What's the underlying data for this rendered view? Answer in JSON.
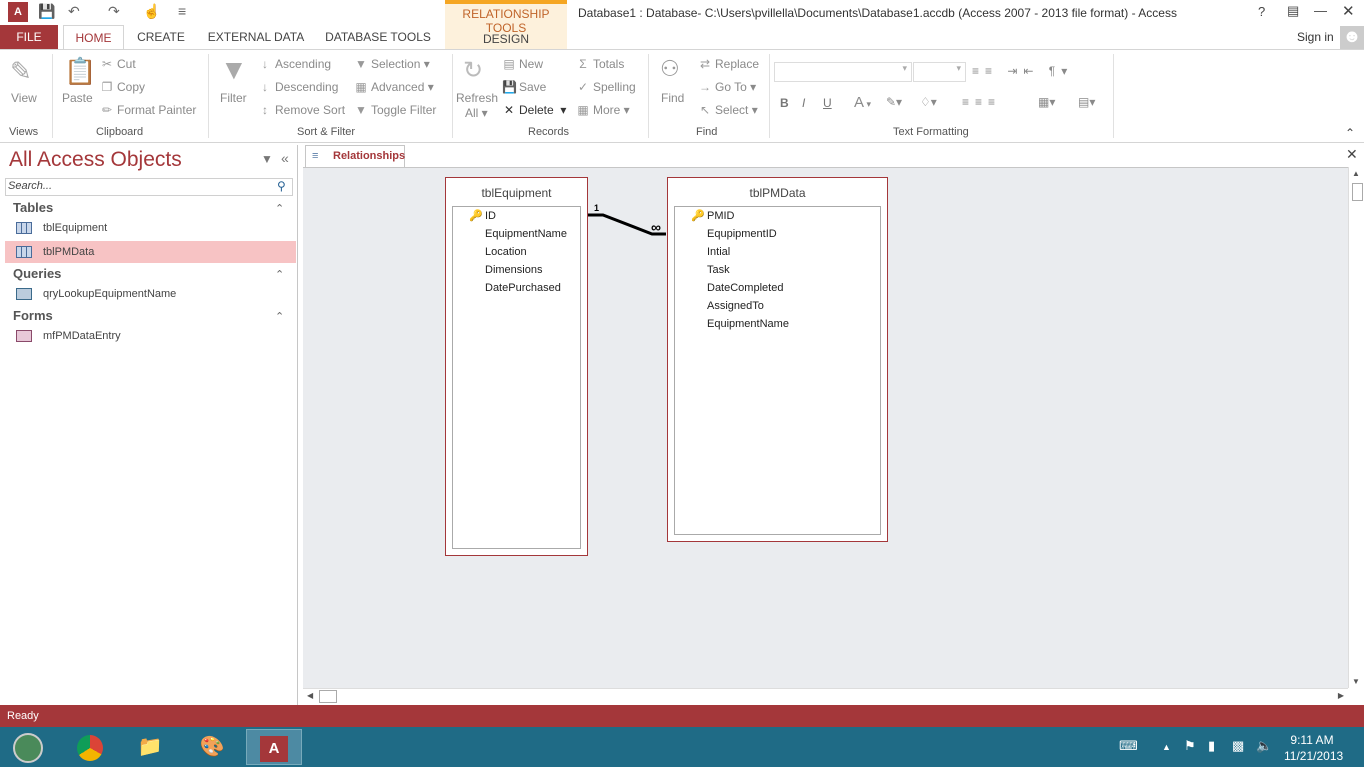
{
  "window": {
    "title": "Database1 : Database- C:\\Users\\pvillella\\Documents\\Database1.accdb (Access 2007 - 2013 file format) - Access",
    "help": "?",
    "sign_in": "Sign in"
  },
  "context_tab": {
    "group": "RELATIONSHIP TOOLS",
    "tab": "DESIGN"
  },
  "tabs": [
    "FILE",
    "HOME",
    "CREATE",
    "EXTERNAL DATA",
    "DATABASE TOOLS"
  ],
  "ribbon": {
    "views": {
      "view": "View",
      "label": "Views"
    },
    "clipboard": {
      "paste": "Paste",
      "cut": "Cut",
      "copy": "Copy",
      "format_painter": "Format Painter",
      "label": "Clipboard"
    },
    "sort_filter": {
      "filter": "Filter",
      "ascending": "Ascending",
      "descending": "Descending",
      "remove_sort": "Remove Sort",
      "selection": "Selection",
      "advanced": "Advanced",
      "toggle_filter": "Toggle Filter",
      "label": "Sort & Filter"
    },
    "records": {
      "refresh": "Refresh",
      "all": "All",
      "new": "New",
      "save": "Save",
      "delete": "Delete",
      "totals": "Totals",
      "spelling": "Spelling",
      "more": "More",
      "label": "Records"
    },
    "find": {
      "find": "Find",
      "replace": "Replace",
      "goto": "Go To",
      "select": "Select",
      "label": "Find"
    },
    "text_formatting": {
      "bold": "B",
      "italic": "I",
      "underline": "U",
      "font_color": "A",
      "label": "Text Formatting"
    }
  },
  "nav": {
    "title": "All Access Objects",
    "search_placeholder": "Search...",
    "groups": [
      {
        "name": "Tables",
        "items": [
          "tblEquipment",
          "tblPMData"
        ]
      },
      {
        "name": "Queries",
        "items": [
          "qryLookupEquipmentName"
        ]
      },
      {
        "name": "Forms",
        "items": [
          "mfPMDataEntry"
        ]
      }
    ]
  },
  "document_tab": "Relationships",
  "tables": [
    {
      "name": "tblEquipment",
      "fields": [
        "ID",
        "EquipmentName",
        "Location",
        "Dimensions",
        "DatePurchased"
      ]
    },
    {
      "name": "tblPMData",
      "fields": [
        "PMID",
        "EqupipmentID",
        "Intial",
        "Task",
        "DateCompleted",
        "AssignedTo",
        "EquipmentName"
      ]
    }
  ],
  "relationship": {
    "one": "1",
    "many": "∞"
  },
  "status": "Ready",
  "clock": {
    "time": "9:11 AM",
    "date": "11/21/2013"
  },
  "colors": {
    "accent": "#a4373a",
    "taskbar": "#1f6b86",
    "selected": "#f7c3c4"
  }
}
